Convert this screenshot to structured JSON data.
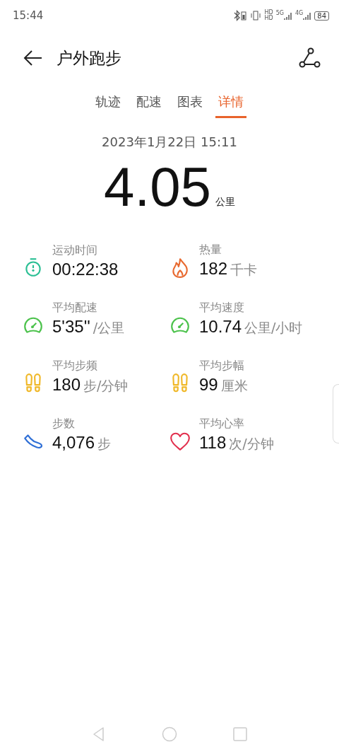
{
  "status_bar": {
    "time": "15:44",
    "hd_top": "HD",
    "hd_bottom": "HD",
    "network_1": "5G",
    "network_2": "4G",
    "battery": "84"
  },
  "header": {
    "title": "户外跑步"
  },
  "tabs": [
    {
      "label": "轨迹",
      "selected": false
    },
    {
      "label": "配速",
      "selected": false
    },
    {
      "label": "图表",
      "selected": false
    },
    {
      "label": "详情",
      "selected": true
    }
  ],
  "date": "2023年1月22日 15:11",
  "distance": {
    "value": "4.05",
    "unit": "公里"
  },
  "metrics": [
    {
      "kind": "stopwatch",
      "color": "#2bbf94",
      "label": "运动时间",
      "value": "00:22:38"
    },
    {
      "kind": "flame",
      "color": "#e86a30",
      "label": "热量",
      "value": "182",
      "unit": "千卡"
    },
    {
      "kind": "gauge",
      "color": "#4cc24c",
      "label": "平均配速",
      "value": "5'35''",
      "unit": "/公里"
    },
    {
      "kind": "gauge",
      "color": "#4cc24c",
      "label": "平均速度",
      "value": "10.74",
      "unit": "公里/小时"
    },
    {
      "kind": "footprints",
      "color": "#f0b829",
      "label": "平均步频",
      "value": "180",
      "unit": "步/分钟"
    },
    {
      "kind": "footprints",
      "color": "#f0b829",
      "label": "平均步幅",
      "value": "99",
      "unit": "厘米"
    },
    {
      "kind": "shoe",
      "color": "#2f6fd6",
      "label": "步数",
      "value": "4,076",
      "unit": "步"
    },
    {
      "kind": "heart",
      "color": "#e2304e",
      "label": "平均心率",
      "value": "118",
      "unit": "次/分钟"
    }
  ]
}
